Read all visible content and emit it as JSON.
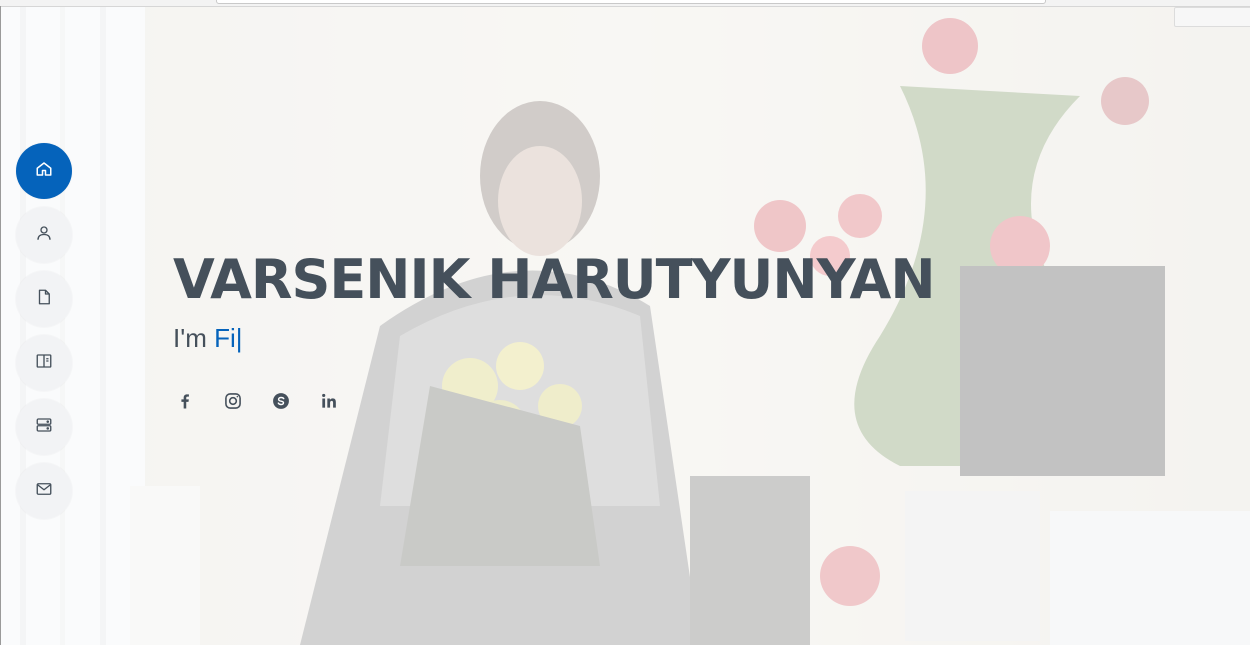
{
  "hero": {
    "name": "VARSENIK HARUTYUNYAN",
    "tagline_prefix": "I'm ",
    "tagline_typed": "Fi",
    "cursor": "|"
  },
  "nav": {
    "items": [
      {
        "icon": "home-icon",
        "active": true
      },
      {
        "icon": "user-icon",
        "active": false
      },
      {
        "icon": "file-icon",
        "active": false
      },
      {
        "icon": "book-icon",
        "active": false
      },
      {
        "icon": "server-icon",
        "active": false
      },
      {
        "icon": "envelope-icon",
        "active": false
      }
    ]
  },
  "social": {
    "items": [
      {
        "icon": "facebook-icon"
      },
      {
        "icon": "instagram-icon"
      },
      {
        "icon": "skype-icon"
      },
      {
        "icon": "linkedin-icon"
      }
    ]
  },
  "colors": {
    "accent": "#0563bb",
    "text": "#45505b",
    "nav_bg": "#f2f3f5"
  }
}
